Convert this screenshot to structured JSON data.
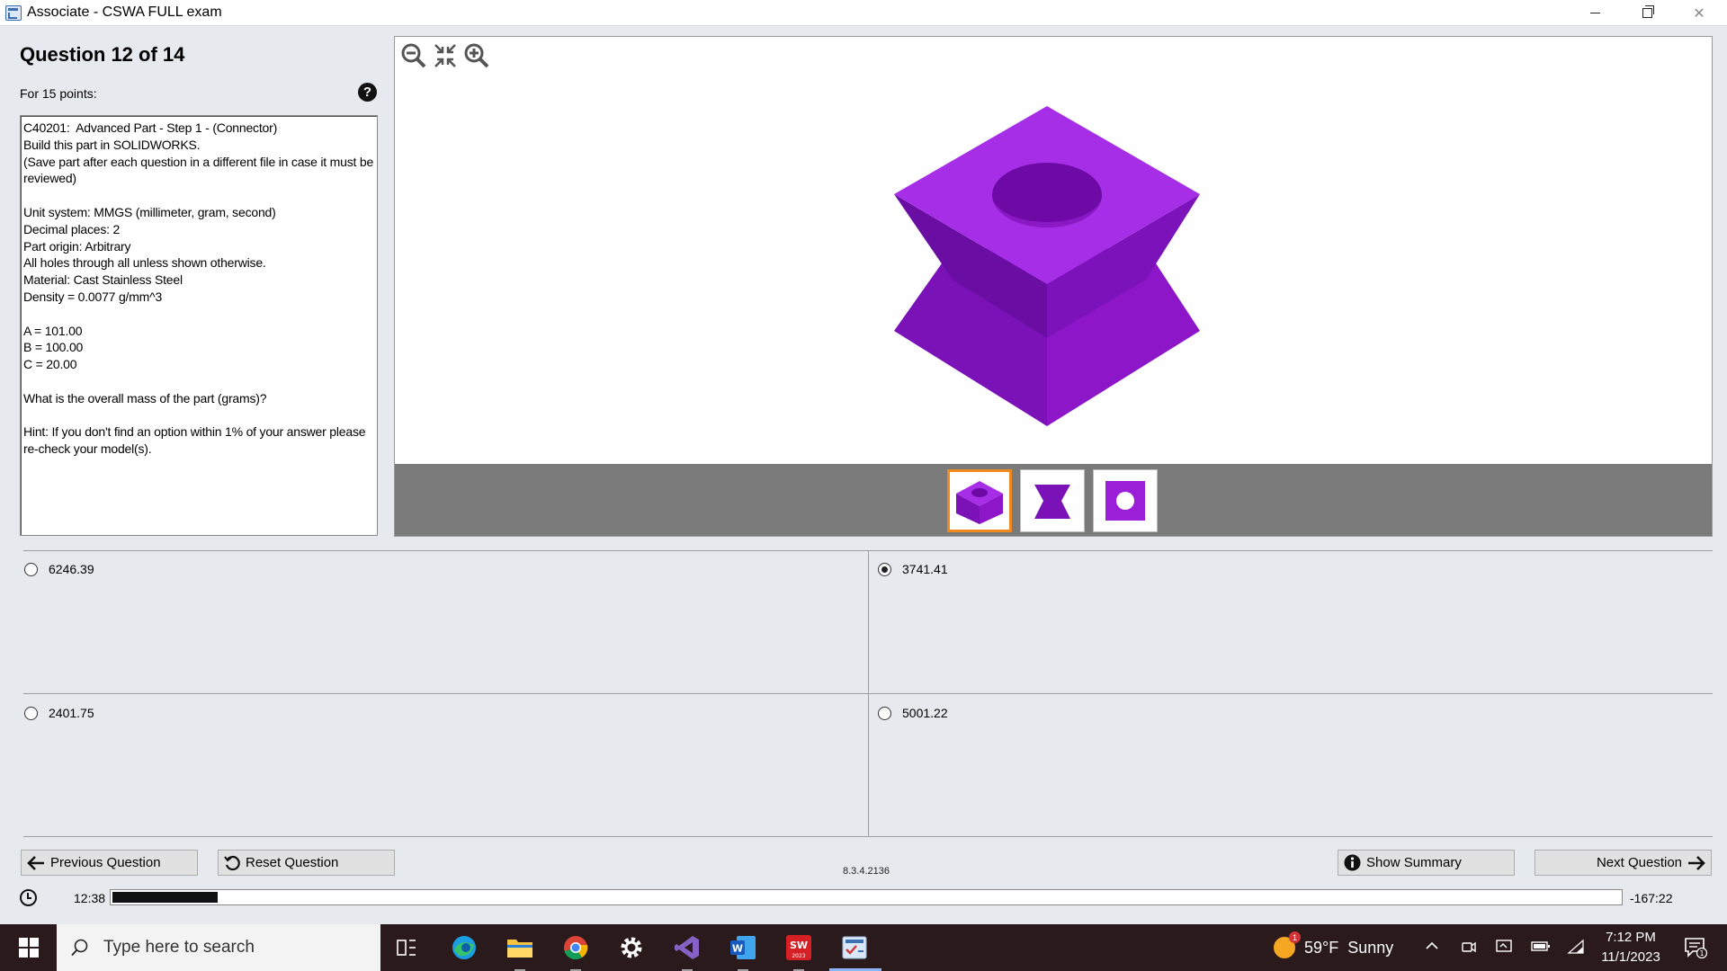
{
  "window": {
    "title": "Associate - CSWA FULL exam"
  },
  "question": {
    "title": "Question 12 of 14",
    "points": "For 15 points:",
    "help": "?",
    "text": "C40201:  Advanced Part - Step 1 - (Connector)\nBuild this part in SOLIDWORKS.\n(Save part after each question in a different file in case it must be reviewed)\n\nUnit system: MMGS (millimeter, gram, second)\nDecimal places: 2\nPart origin: Arbitrary\nAll holes through all unless shown otherwise.\nMaterial: Cast Stainless Steel\nDensity = 0.0077 g/mm^3\n\nA = 101.00\nB = 100.00\nC = 20.00\n\nWhat is the overall mass of the part (grams)?\n\nHint: If you don't find an option within 1% of your answer please re-check your model(s)."
  },
  "viewer": {
    "tools": [
      "zoom-out-icon",
      "fit-icon",
      "zoom-in-icon"
    ],
    "part_color": "#9b1fd6",
    "thumbnails": [
      {
        "name": "isometric-view",
        "active": true
      },
      {
        "name": "front-view",
        "active": false
      },
      {
        "name": "top-view",
        "active": false
      }
    ],
    "active_thumb_color": "#f08a1f"
  },
  "answers": [
    {
      "label": "6246.39",
      "selected": false
    },
    {
      "label": "3741.41",
      "selected": true
    },
    {
      "label": "2401.75",
      "selected": false
    },
    {
      "label": "5001.22",
      "selected": false
    }
  ],
  "buttons": {
    "previous": "Previous Question",
    "reset": "Reset Question",
    "summary": "Show Summary",
    "next": "Next Question"
  },
  "version": "8.3.4.2136",
  "timer": {
    "elapsed": "12:38",
    "remaining": "-167:22",
    "progress": 0.07
  },
  "taskbar": {
    "search_placeholder": "Type here to search",
    "apps": [
      "task-view-icon",
      "edge-icon",
      "file-explorer-icon",
      "chrome-icon",
      "settings-icon",
      "visual-studio-icon",
      "word-icon",
      "solidworks-icon",
      "exam-app-icon"
    ],
    "solidworks_label": "2023",
    "weather": {
      "temp": "59°F",
      "condition": "Sunny",
      "badge": "1"
    },
    "time": "7:12 PM",
    "date": "11/1/2023",
    "notifications": "1"
  }
}
